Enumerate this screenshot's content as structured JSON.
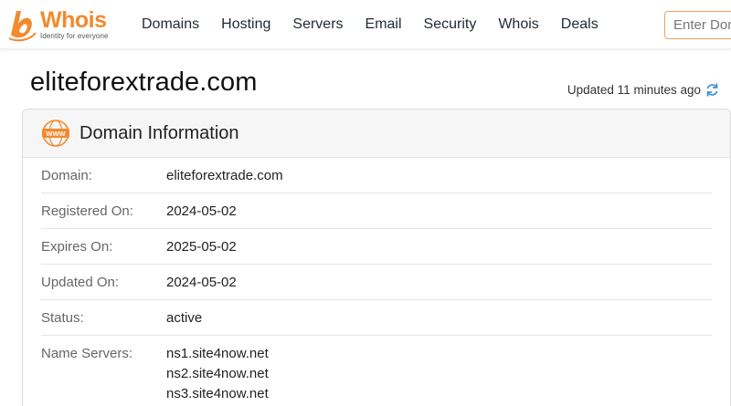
{
  "header": {
    "logo_name": "Whois",
    "logo_tagline": "Identity for everyone",
    "nav": [
      "Domains",
      "Hosting",
      "Servers",
      "Email",
      "Security",
      "Whois",
      "Deals"
    ],
    "search_placeholder": "Enter Domain"
  },
  "page": {
    "title": "eliteforextrade.com",
    "updated_text": "Updated 11 minutes ago"
  },
  "card": {
    "icon": "www-globe-icon",
    "title": "Domain Information",
    "rows": [
      {
        "label": "Domain:",
        "value": "eliteforextrade.com"
      },
      {
        "label": "Registered On:",
        "value": "2024-05-02"
      },
      {
        "label": "Expires On:",
        "value": "2025-05-02"
      },
      {
        "label": "Updated On:",
        "value": "2024-05-02"
      },
      {
        "label": "Status:",
        "value": "active"
      }
    ],
    "name_servers_label": "Name Servers:",
    "name_servers": [
      "ns1.site4now.net",
      "ns2.site4now.net",
      "ns3.site4now.net"
    ]
  },
  "colors": {
    "brand_orange": "#f28a2e",
    "refresh_blue": "#3b8fd9"
  }
}
